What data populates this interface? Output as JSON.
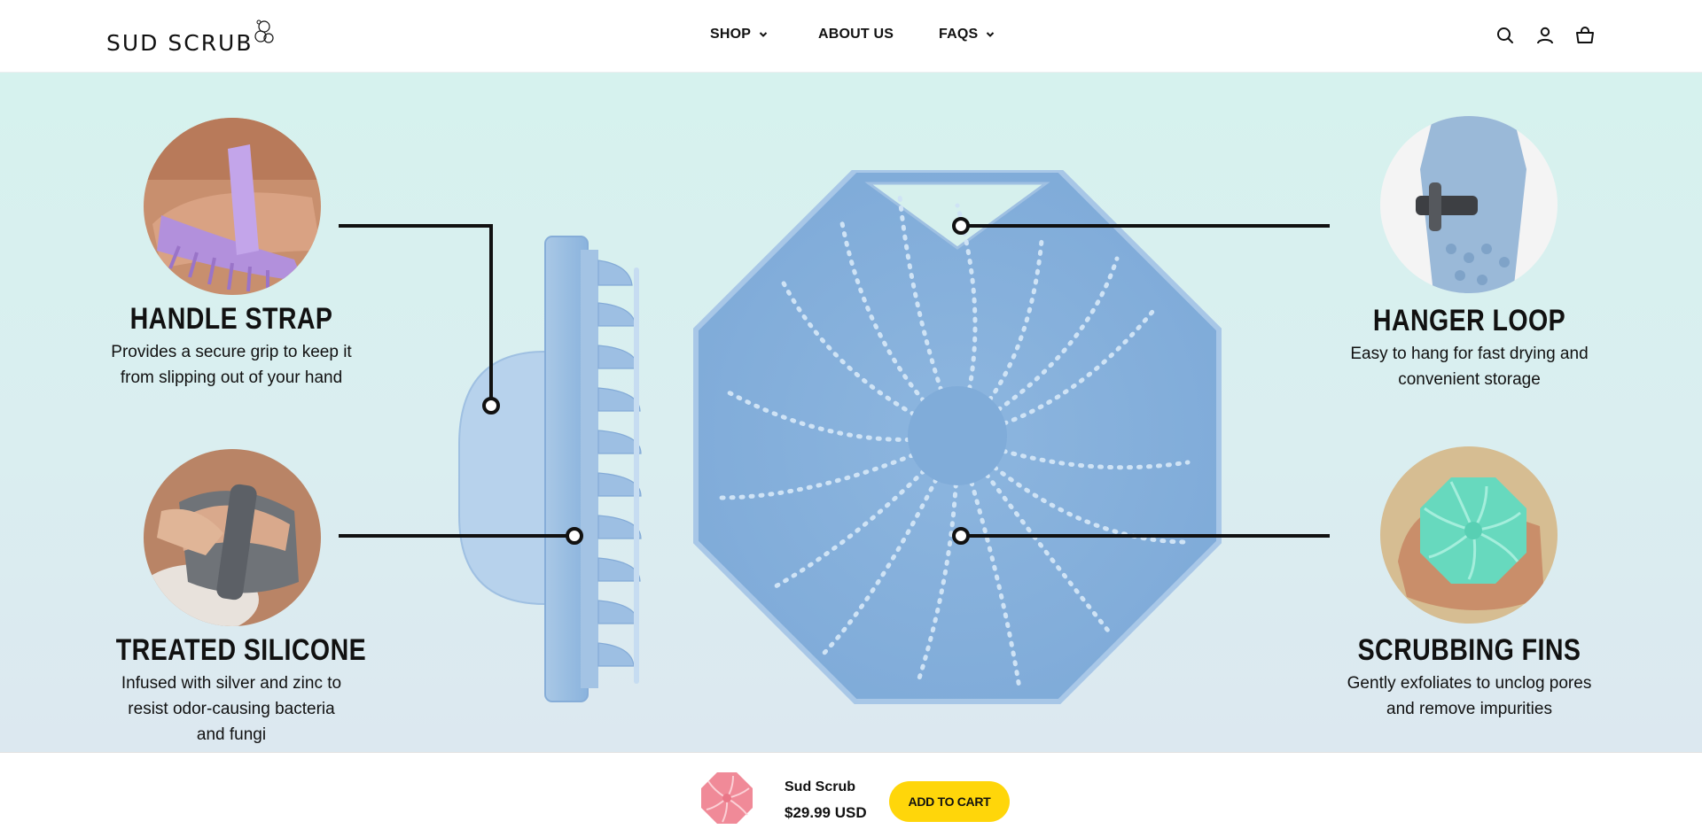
{
  "header": {
    "logo_text": "SUD SCRUB",
    "nav": [
      {
        "label": "SHOP",
        "has_dropdown": true
      },
      {
        "label": "ABOUT US",
        "has_dropdown": false
      },
      {
        "label": "FAQS",
        "has_dropdown": true
      }
    ],
    "icons": [
      "search-icon",
      "account-icon",
      "cart-icon"
    ]
  },
  "features": {
    "handle_strap": {
      "title": "HANDLE STRAP",
      "desc_line1": "Provides a secure grip to keep it",
      "desc_line2": "from slipping out of your hand"
    },
    "treated_silicone": {
      "title": "TREATED SILICONE",
      "desc_line1": "Infused with silver and zinc to",
      "desc_line2": "resist odor-causing bacteria",
      "desc_line3": "and fungi"
    },
    "hanger_loop": {
      "title": "HANGER LOOP",
      "desc_line1": "Easy to hang for fast drying and",
      "desc_line2": "convenient storage"
    },
    "scrubbing_fins": {
      "title": "SCRUBBING FINS",
      "desc_line1": "Gently exfoliates to unclog pores",
      "desc_line2": "and remove impurities"
    }
  },
  "sticky_bar": {
    "product_name": "Sud Scrub",
    "price": "$29.99 USD",
    "add_to_cart_label": "ADD TO CART"
  },
  "colors": {
    "accent_button": "#ffd60a",
    "scrubber_blue": "#8fb8e0",
    "hero_bg": "#d6f2ee"
  }
}
